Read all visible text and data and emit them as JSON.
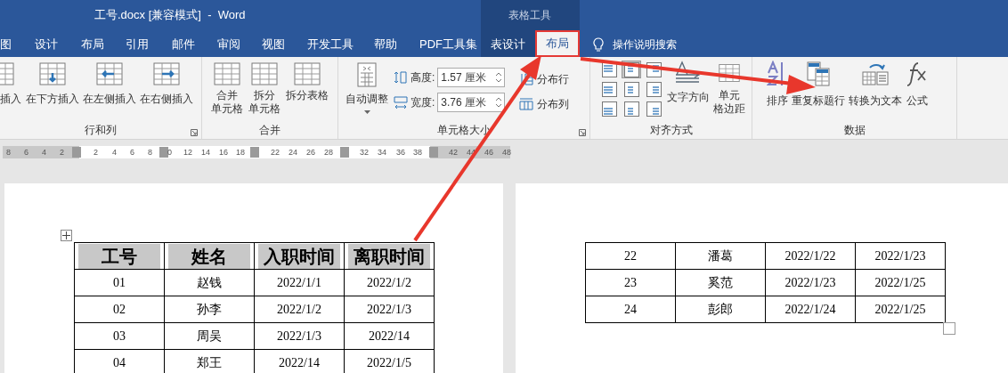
{
  "window": {
    "title": "工号.docx [兼容模式]  -  Word",
    "context_label": "表格工具"
  },
  "tabs": [
    {
      "label": "图",
      "selected": false
    },
    {
      "label": "设计",
      "selected": false
    },
    {
      "label": "布局",
      "selected": false
    },
    {
      "label": "引用",
      "selected": false
    },
    {
      "label": "邮件",
      "selected": false
    },
    {
      "label": "审阅",
      "selected": false
    },
    {
      "label": "视图",
      "selected": false
    },
    {
      "label": "开发工具",
      "selected": false
    },
    {
      "label": "帮助",
      "selected": false
    },
    {
      "label": "PDF工具集",
      "selected": false
    },
    {
      "label": "表设计",
      "selected": false
    },
    {
      "label": "布局",
      "selected": true
    }
  ],
  "search": {
    "label": "操作说明搜索"
  },
  "ribbon": {
    "rows_columns": {
      "label": "行和列",
      "buttons": [
        "插入",
        "在下方插入",
        "在左侧插入",
        "在右侧插入"
      ]
    },
    "merge": {
      "label": "合并",
      "buttons": [
        [
          "合并",
          "单元格"
        ],
        [
          "拆分",
          "单元格"
        ],
        [
          "拆分表格"
        ]
      ]
    },
    "cell_size": {
      "label": "单元格大小",
      "autofit": "自动调整",
      "height": {
        "label": "高度:",
        "value": "1.57 厘米"
      },
      "width": {
        "label": "宽度:",
        "value": "3.76 厘米"
      },
      "distribute_rows": "分布行",
      "distribute_columns": "分布列"
    },
    "alignment": {
      "label": "对齐方式",
      "options": [
        {
          "selected": false
        },
        {
          "selected": true
        },
        {
          "selected": false
        },
        {
          "selected": false
        },
        {
          "selected": false
        },
        {
          "selected": false
        },
        {
          "selected": false
        },
        {
          "selected": false
        },
        {
          "selected": false
        }
      ],
      "text_direction": "文字方向",
      "cell_margins": [
        "单元",
        "格边距"
      ]
    },
    "data": {
      "label": "数据",
      "buttons": [
        "排序",
        "重复标题行",
        "转换为文本",
        "公式"
      ]
    }
  },
  "ruler": {
    "labels": [
      "8",
      "6",
      "4",
      "2",
      "2",
      "4",
      "6",
      "8",
      "0",
      "12",
      "14",
      "16",
      "18",
      "22",
      "24",
      "26",
      "28",
      "32",
      "34",
      "36",
      "38",
      "42",
      "44",
      "46",
      "48"
    ]
  },
  "left_page": {
    "table": {
      "columns": [
        "工号",
        "姓名",
        "入职时间",
        "离职时间"
      ],
      "rows": [
        [
          "01",
          "赵钱",
          "2022/1/1",
          "2022/1/2"
        ],
        [
          "02",
          "孙李",
          "2022/1/2",
          "2022/1/3"
        ],
        [
          "03",
          "周吴",
          "2022/1/3",
          "2022/14"
        ],
        [
          "04",
          "郑王",
          "2022/14",
          "2022/1/5"
        ]
      ]
    }
  },
  "right_page": {
    "table": {
      "rows": [
        [
          "22",
          "潘葛",
          "2022/1/22",
          "2022/1/23"
        ],
        [
          "23",
          "奚范",
          "2022/1/23",
          "2022/1/25"
        ],
        [
          "24",
          "彭郎",
          "2022/1/24",
          "2022/1/25"
        ]
      ]
    }
  }
}
